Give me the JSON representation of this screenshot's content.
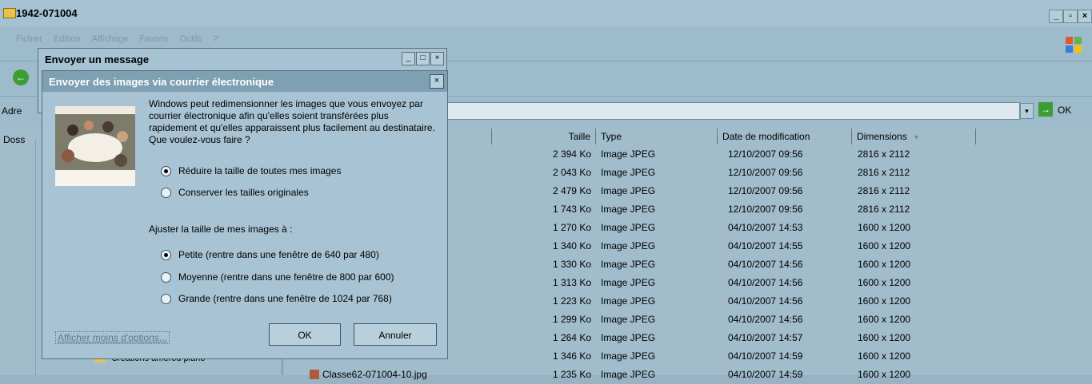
{
  "window": {
    "title": "1942-071004"
  },
  "menubar": {
    "items": [
      "Fichier",
      "Edition",
      "Affichage",
      "Favoris",
      "Outils",
      "?"
    ]
  },
  "address": {
    "label": "Adre",
    "go_label": "OK",
    "dropdown_icon": "▾",
    "go_icon": "→"
  },
  "left_pane": {
    "header": "Doss",
    "tree_item": "Créations amérod plano"
  },
  "columns": {
    "size": "Taille",
    "type": "Type",
    "date": "Date de modification",
    "dimensions": "Dimensions"
  },
  "files": [
    {
      "name": "",
      "size": "2 394 Ko",
      "type": "Image JPEG",
      "date": "12/10/2007 09:56",
      "dims": "2816 x 2112"
    },
    {
      "name": "",
      "size": "2 043 Ko",
      "type": "Image JPEG",
      "date": "12/10/2007 09:56",
      "dims": "2816 x 2112"
    },
    {
      "name": "",
      "size": "2 479 Ko",
      "type": "Image JPEG",
      "date": "12/10/2007 09:56",
      "dims": "2816 x 2112"
    },
    {
      "name": "",
      "size": "1 743 Ko",
      "type": "Image JPEG",
      "date": "12/10/2007 09:56",
      "dims": "2816 x 2112"
    },
    {
      "name": "",
      "size": "1 270 Ko",
      "type": "Image JPEG",
      "date": "04/10/2007 14:53",
      "dims": "1600 x 1200"
    },
    {
      "name": "",
      "size": "1 340 Ko",
      "type": "Image JPEG",
      "date": "04/10/2007 14:55",
      "dims": "1600 x 1200"
    },
    {
      "name": "",
      "size": "1 330 Ko",
      "type": "Image JPEG",
      "date": "04/10/2007 14:56",
      "dims": "1600 x 1200"
    },
    {
      "name": "",
      "size": "1 313 Ko",
      "type": "Image JPEG",
      "date": "04/10/2007 14:56",
      "dims": "1600 x 1200"
    },
    {
      "name": "",
      "size": "1 223 Ko",
      "type": "Image JPEG",
      "date": "04/10/2007 14:56",
      "dims": "1600 x 1200"
    },
    {
      "name": "",
      "size": "1 299 Ko",
      "type": "Image JPEG",
      "date": "04/10/2007 14:56",
      "dims": "1600 x 1200"
    },
    {
      "name": "",
      "size": "1 264 Ko",
      "type": "Image JPEG",
      "date": "04/10/2007 14:57",
      "dims": "1600 x 1200"
    },
    {
      "name": "",
      "size": "1 346 Ko",
      "type": "Image JPEG",
      "date": "04/10/2007 14:59",
      "dims": "1600 x 1200"
    },
    {
      "name": "Classe62-071004-10.jpg",
      "size": "1 235 Ko",
      "type": "Image JPEG",
      "date": "04/10/2007 14:59",
      "dims": "1600 x 1200"
    }
  ],
  "dialog_message": {
    "title": "Envoyer un message"
  },
  "dialog_images": {
    "title": "Envoyer des images via courrier électronique",
    "intro": "Windows peut redimensionner les images que vous envoyez par courrier électronique afin qu'elles soient transférées plus rapidement et qu'elles apparaissent plus facilement au destinataire. Que voulez-vous faire ?",
    "option_reduce": "Réduire la taille de toutes mes images",
    "option_keep": "Conserver les tailles originales",
    "adjust_label": "Ajuster la taille de mes images à :",
    "size_small": "Petite (rentre dans une fenêtre de 640 par 480)",
    "size_medium": "Moyenne (rentre dans une fenêtre de 800 par 600)",
    "size_large": "Grande (rentre dans une fenêtre de 1024 par 768)",
    "fewer_options": "Afficher moins d'options...",
    "ok": "OK",
    "cancel": "Annuler"
  },
  "icons": {
    "minimize": "_",
    "maximize": "□",
    "restore": "▫",
    "close": "×",
    "sort": "▾",
    "back": "←"
  }
}
